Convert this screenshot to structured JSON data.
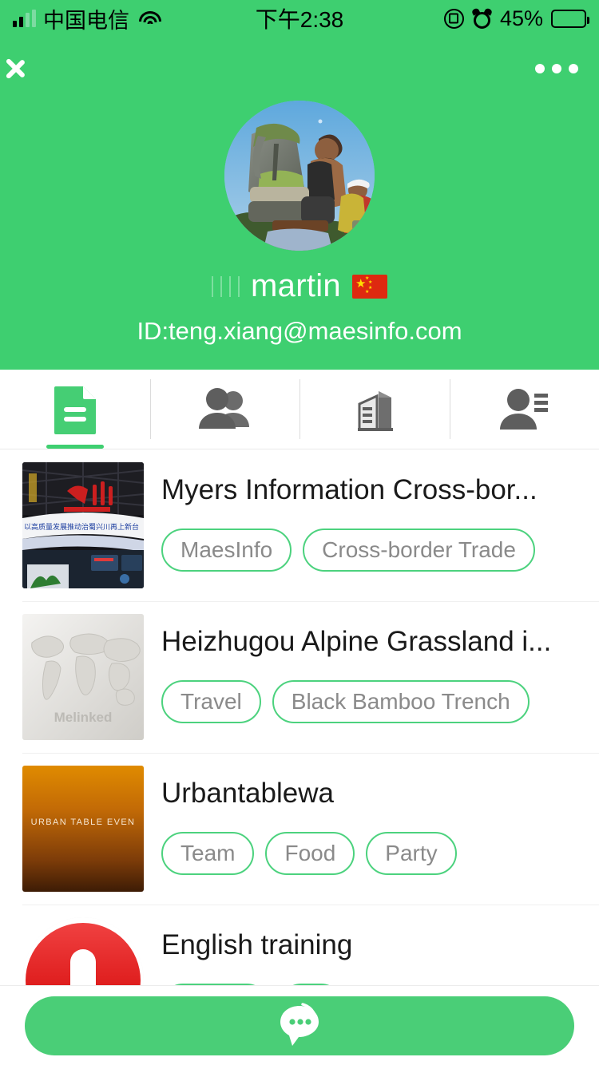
{
  "status_bar": {
    "carrier": "中国电信",
    "time": "下午2:38",
    "battery_percent": "45%",
    "battery_level": 45,
    "icons": [
      "signal-bars-icon",
      "wifi-icon",
      "rotation-lock-icon",
      "alarm-clock-icon",
      "battery-icon"
    ]
  },
  "nav_bar": {
    "back_icon": "back-chevron-icon",
    "more_icon": "more-options-icon"
  },
  "profile": {
    "avatar_alt": "hikers-with-backpacks-photo",
    "username": "martin",
    "flag": "china-flag",
    "user_id": "ID:teng.xiang@maesinfo.com"
  },
  "tabs": [
    {
      "name": "documents",
      "icon": "document-icon",
      "active": true
    },
    {
      "name": "groups",
      "icon": "people-group-icon",
      "active": false
    },
    {
      "name": "company",
      "icon": "building-icon",
      "active": false
    },
    {
      "name": "contact-details",
      "icon": "person-details-icon",
      "active": false
    }
  ],
  "list": [
    {
      "title": "Myers Information Cross-bor...",
      "thumb": "exhibition-hall-photo",
      "tags": [
        "MaesInfo",
        "Cross-border Trade"
      ]
    },
    {
      "title": "Heizhugou Alpine Grassland i...",
      "thumb": "melinked-world-map-placeholder",
      "thumb_watermark": "Melinked",
      "tags": [
        "Travel",
        "Black Bamboo Trench"
      ]
    },
    {
      "title": "Urbantablewa",
      "thumb": "urban-table-event-banner",
      "thumb_caption": "URBAN TABLE EVEN",
      "tags": [
        "Team",
        "Food",
        "Party"
      ]
    },
    {
      "title": "English training",
      "thumb": "red-microphone-logo",
      "tags": []
    }
  ],
  "bottom_action": {
    "icon": "chat-bubble-icon",
    "label": ""
  },
  "colors": {
    "brand_green": "#3ECF70",
    "button_green": "#4ACE77",
    "tag_border": "#4CD27E",
    "tag_text": "#8a8a8a",
    "title_text": "#1a1a1a"
  }
}
